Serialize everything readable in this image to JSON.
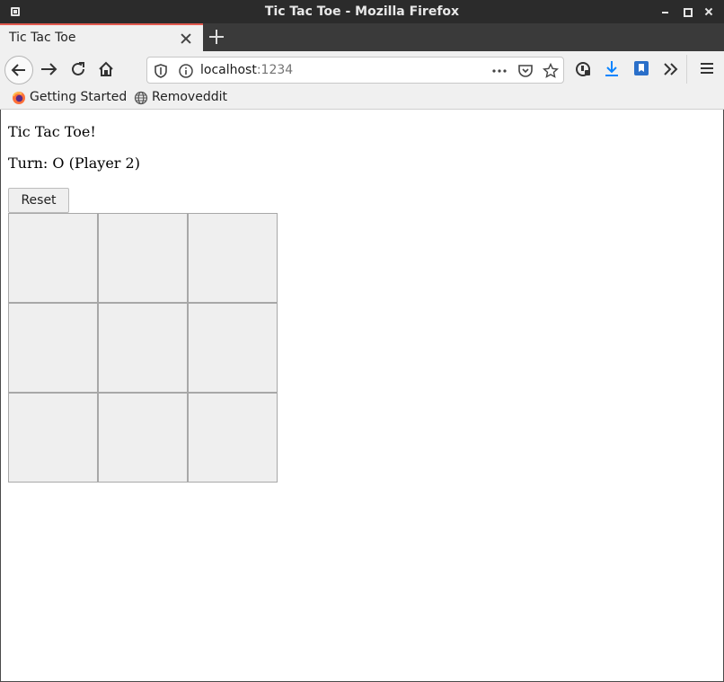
{
  "window": {
    "title": "Tic Tac Toe - Mozilla Firefox"
  },
  "tabs": [
    {
      "label": "Tic Tac Toe",
      "active": true
    }
  ],
  "navbar": {
    "url_host": "localhost",
    "url_port": ":1234",
    "icons": [
      "back-icon",
      "forward-icon",
      "reload-icon",
      "home-icon",
      "shield-icon",
      "info-icon",
      "more-icon",
      "pocket-icon",
      "star-icon",
      "extension-icon",
      "download-icon",
      "bookmark-icon",
      "overflow-icon",
      "menu-icon"
    ]
  },
  "bookmarks": [
    {
      "label": "Getting Started",
      "icon": "firefox-icon"
    },
    {
      "label": "Removeddit",
      "icon": "globe-icon"
    }
  ],
  "page": {
    "heading": "Tic Tac Toe!",
    "turn": "Turn: O (Player 2)",
    "reset_label": "Reset",
    "board": [
      "",
      "",
      "",
      "",
      "",
      "",
      "",
      "",
      ""
    ]
  },
  "colors": {
    "titlebar": "#2b2b2b",
    "tab_accent": "#e25a4f",
    "toolbar": "#f0f0f0",
    "cell_bg": "#efefef",
    "download_blue": "#0a84ff"
  }
}
